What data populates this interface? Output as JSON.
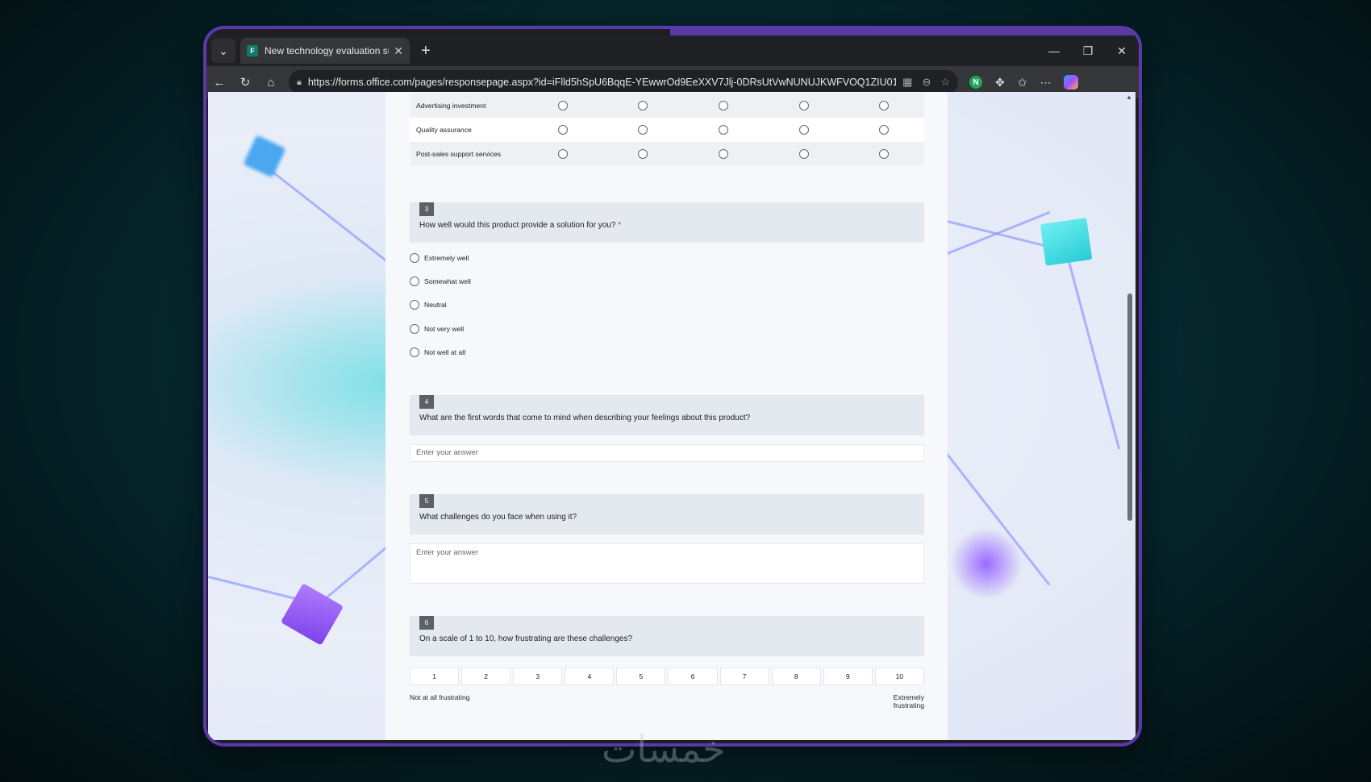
{
  "browser": {
    "tab_title": "New technology evaluation survey",
    "url": "https://forms.office.com/pages/responsepage.aspx?id=iFlld5hSpU6BqqE-YEwwrOd9EeXXV7Jlj-0DRsUtVwNUNUJKWFVOQ1ZIU01B...",
    "extension_badge": "N"
  },
  "likert_rows": [
    {
      "label": "Advertising investment"
    },
    {
      "label": "Quality assurance"
    },
    {
      "label": "Post-sales support services"
    }
  ],
  "q3": {
    "number": "3",
    "text": "How well would this product provide a solution for you?",
    "required_mark": "*",
    "options": [
      "Extremely well",
      "Somewhat well",
      "Neutral",
      "Not very well",
      "Not well at all"
    ]
  },
  "q4": {
    "number": "4",
    "text": "What are the first words that come to mind when describing your feelings about this product?",
    "placeholder": "Enter your answer"
  },
  "q5": {
    "number": "5",
    "text": "What challenges do you face when using it?",
    "placeholder": "Enter your answer"
  },
  "q6": {
    "number": "6",
    "text": "On a scale of 1 to 10, how frustrating are these challenges?",
    "scale": [
      "1",
      "2",
      "3",
      "4",
      "5",
      "6",
      "7",
      "8",
      "9",
      "10"
    ],
    "left_label": "Not at all frustrating",
    "right_label": "Extremely frustrating"
  },
  "watermark": "خمسات"
}
